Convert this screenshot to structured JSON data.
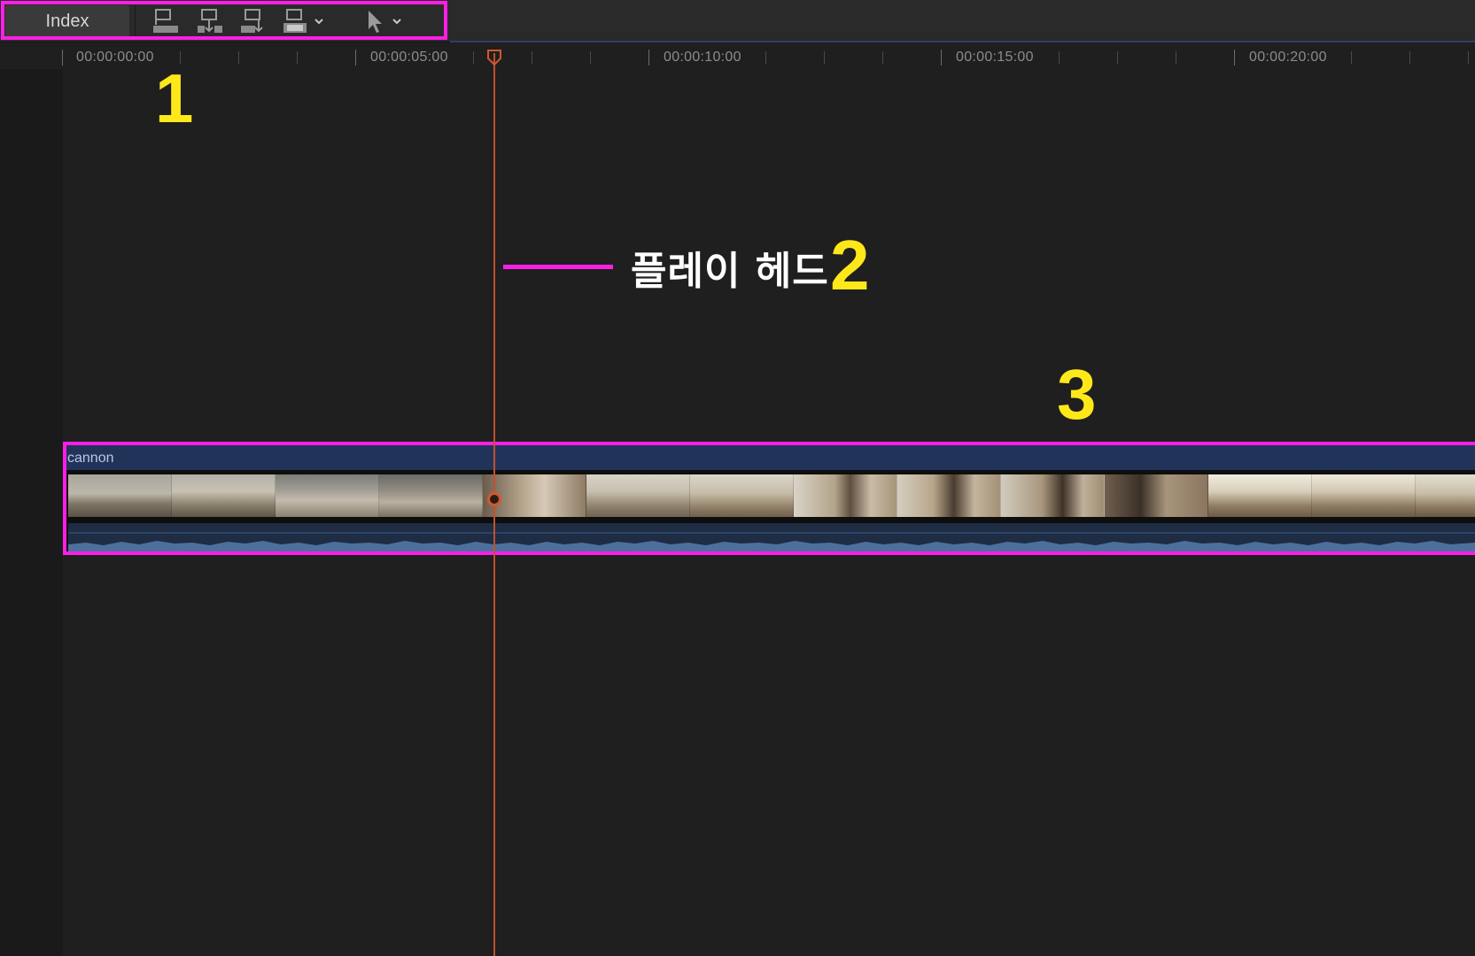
{
  "toolbar": {
    "index_label": "Index",
    "icons": [
      "connect-clip-icon",
      "insert-clip-icon",
      "append-clip-icon",
      "overwrite-clip-icon",
      "select-tool-icon"
    ]
  },
  "ruler": {
    "labels": [
      "00:00:00:00",
      "00:00:05:00",
      "00:00:10:00",
      "00:00:15:00",
      "00:00:20:00"
    ]
  },
  "annotations": {
    "one": "1",
    "two": "2",
    "three": "3",
    "playhead_label": "플레이 헤드"
  },
  "clip": {
    "name": "cannon"
  },
  "colors": {
    "highlight": "#ff1ee6",
    "annotation_number": "#ffe81a",
    "playhead": "#c2502e",
    "clip_title_bar": "#22335a"
  }
}
